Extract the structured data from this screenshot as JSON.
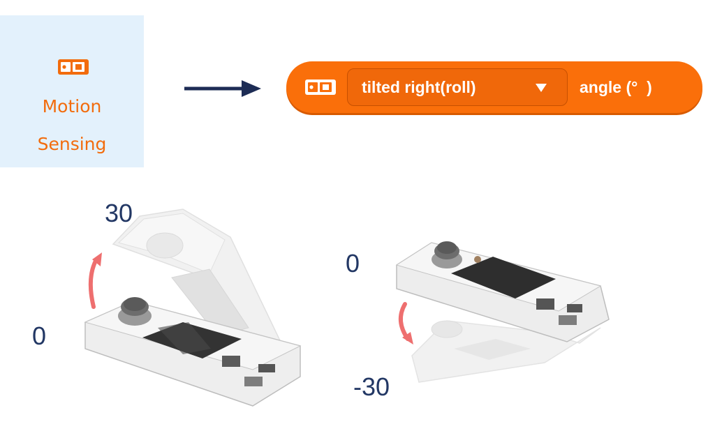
{
  "category": {
    "icon": "controller-icon",
    "label_line1": "Motion",
    "label_line2": "Sensing",
    "color": "#f26c0d",
    "background": "#e3f1fc"
  },
  "block": {
    "icon": "controller-icon",
    "dropdown_value": "tilted right(roll)",
    "caret": "▼",
    "suffix": "angle (°  )",
    "color": "#fa6f0a"
  },
  "illustration_left": {
    "top_label": "30",
    "bottom_label": "0",
    "arrow_color": "#ee6f6f"
  },
  "illustration_right": {
    "top_label": "0",
    "bottom_label": "-30",
    "arrow_color": "#ee6f6f"
  }
}
